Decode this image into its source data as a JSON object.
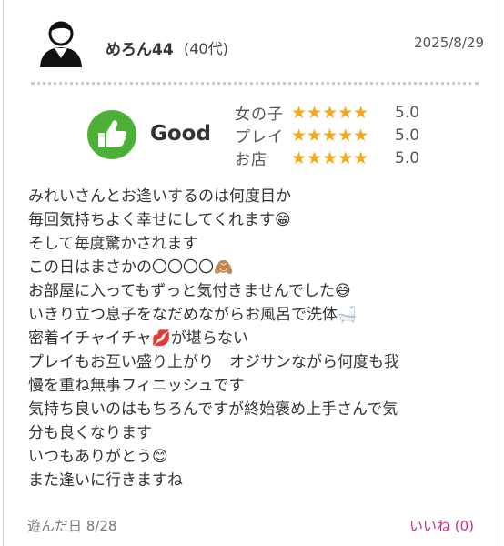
{
  "review": {
    "user_name": "めろん44",
    "user_age": "(40代)",
    "date": "2025/8/29",
    "rating_label": "Good",
    "scores": [
      {
        "label": "女の子",
        "stars": "★★★★★",
        "value": "5.0",
        "stars_count": 5
      },
      {
        "label": "プレイ",
        "stars": "★★★★★",
        "value": "5.0",
        "stars_count": 5
      },
      {
        "label": "お店",
        "stars": "★★★★★",
        "value": "5.0",
        "stars_count": 5
      }
    ],
    "body_lines": [
      "みれいさんとお逢いするのは何度目か",
      "毎回気持ちよく幸せにしてくれます😁",
      "そして毎度驚かされます",
      "この日はまさかの〇〇〇〇🙈",
      "お部屋に入ってもずっと気付きませんでした😅",
      "いきり立つ息子をなだめながらお風呂で洗体🛁",
      "密着イチャイチャ💋が堪らない",
      "プレイもお互い盛り上がり　オジサンながら何度も我",
      "慢を重ね無事フィニッシュです",
      "気持ち良いのはもちろんですが終始褒め上手さんで気",
      "分も良くなります",
      "いつもありがとう😊",
      "また逢いに行きますね"
    ],
    "played_date": "遊んだ日 8/28",
    "like_label": "いいね (0)"
  },
  "icons": {
    "avatar": "user-avatar-icon",
    "thumb": "thumbs-up-icon"
  },
  "colors": {
    "thumb_green": "#4caf36",
    "star": "#f2a91c",
    "like": "#d12a86"
  }
}
